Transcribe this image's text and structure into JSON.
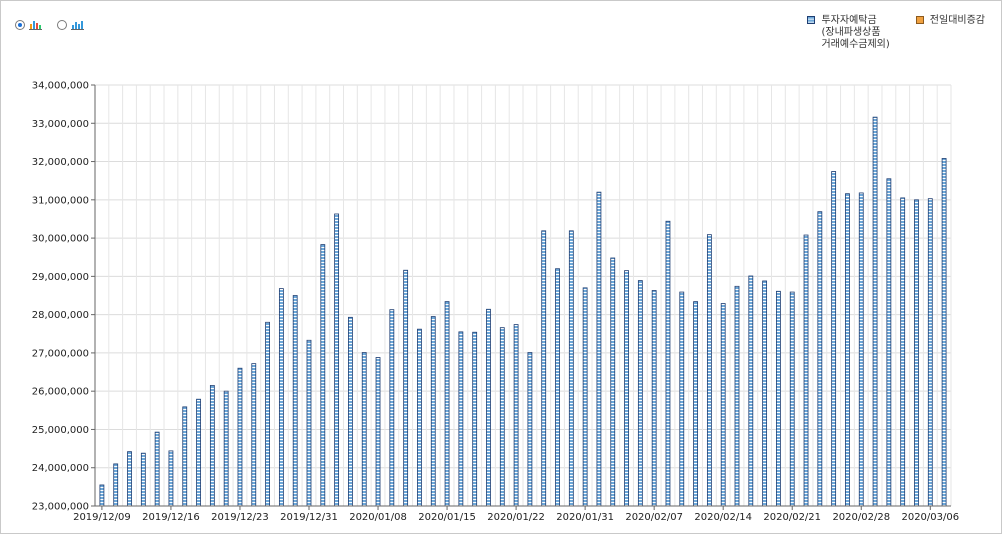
{
  "toolbar": {
    "options": [
      {
        "name": "chart-type-a",
        "selected": true
      },
      {
        "name": "chart-type-b",
        "selected": false
      }
    ]
  },
  "legend": [
    {
      "label": "투자자예탁금\n(장내파생상품\n거래예수금제외)",
      "color": "#6da8d9"
    },
    {
      "label": "전일대비증감",
      "color": "#f0a140"
    }
  ],
  "chart_data": {
    "type": "bar",
    "title": "",
    "xlabel": "",
    "ylabel": "",
    "ylim": [
      23000000,
      34000000
    ],
    "yticks": [
      23000000,
      24000000,
      25000000,
      26000000,
      27000000,
      28000000,
      29000000,
      30000000,
      31000000,
      32000000,
      33000000,
      34000000
    ],
    "ytick_labels": [
      "23,000,000",
      "24,000,000",
      "25,000,000",
      "26,000,000",
      "27,000,000",
      "28,000,000",
      "29,000,000",
      "30,000,000",
      "31,000,000",
      "32,000,000",
      "33,000,000",
      "34,000,000"
    ],
    "x_tick_labels": [
      "2019/12/09",
      "2019/12/16",
      "2019/12/23",
      "2019/12/31",
      "2020/01/08",
      "2020/01/15",
      "2020/01/22",
      "2020/01/31",
      "2020/02/07",
      "2020/02/14",
      "2020/02/21",
      "2020/02/28",
      "2020/03/06"
    ],
    "x_tick_indices": [
      0,
      5,
      10,
      15,
      20,
      25,
      30,
      35,
      40,
      45,
      50,
      55,
      60
    ],
    "grid": true,
    "legend_position": "top-right",
    "series": [
      {
        "color": "#6da8d9",
        "values": [
          23550000,
          24100000,
          24420000,
          24380000,
          24930000,
          24440000,
          25590000,
          25790000,
          26150000,
          26000000,
          26600000,
          26720000,
          27800000,
          28680000,
          28500000,
          27330000,
          29830000,
          30630000,
          27930000,
          27010000,
          26880000,
          28130000,
          29160000,
          27620000,
          27950000,
          28340000,
          27550000,
          27540000,
          28140000,
          27660000,
          27740000,
          27010000,
          30190000,
          29200000,
          30190000,
          28700000,
          31200000,
          29480000,
          29150000,
          28890000,
          28630000,
          30440000,
          28590000,
          28340000,
          30090000,
          28290000,
          28740000,
          29010000,
          28880000,
          28610000,
          28590000,
          30080000,
          30690000,
          31740000,
          31160000,
          31180000,
          33160000,
          31550000,
          31050000,
          31000000,
          31030000,
          32080000
        ]
      }
    ]
  }
}
